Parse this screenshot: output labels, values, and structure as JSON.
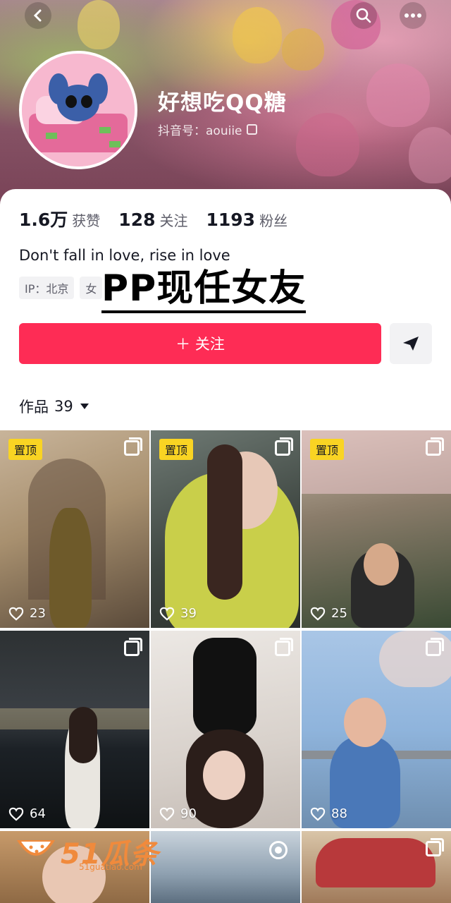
{
  "profile": {
    "nickname": "好想吃QQ糖",
    "douyin_id": "抖音号：aouiie",
    "bio": "Don't fall in love, rise in love",
    "tags": [
      "IP：北京",
      "女"
    ]
  },
  "stats": [
    {
      "value": "1.6万",
      "label": "获赞"
    },
    {
      "value": "128",
      "label": "关注"
    },
    {
      "value": "1193",
      "label": "粉丝"
    }
  ],
  "overlay": "PP现任女友",
  "actions": {
    "follow_label": "＋ 关注"
  },
  "works": {
    "label": "作品",
    "count": "39"
  },
  "grid": [
    {
      "pinned": "置顶",
      "likes": "23",
      "multi": true
    },
    {
      "pinned": "置顶",
      "likes": "39",
      "multi": true
    },
    {
      "pinned": "置顶",
      "likes": "25",
      "multi": true
    },
    {
      "pinned": "",
      "likes": "64",
      "multi": true
    },
    {
      "pinned": "",
      "likes": "90",
      "multi": true
    },
    {
      "pinned": "",
      "likes": "88",
      "multi": true
    }
  ],
  "watermark": {
    "logo": "51瓜条",
    "url": "51guatiao.com"
  },
  "colors": {
    "accent": "#fe2c55",
    "pin": "#f9d423"
  }
}
